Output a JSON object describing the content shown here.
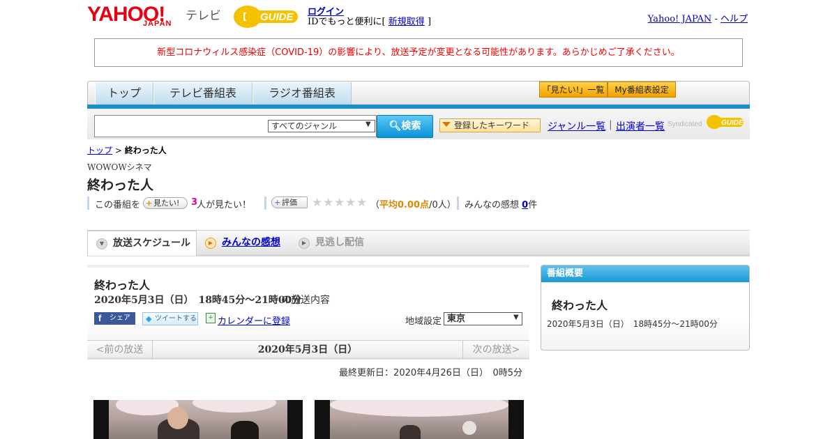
{
  "header": {
    "logo_yahoo": "YAHOO!",
    "logo_japan": "JAPAN",
    "logo_tv": "テレビ",
    "logo_gguide": "GUIDE",
    "login_label": "ログイン",
    "login_sub_prefix": "IDでもっと便利に[",
    "signup_label": "新規取得",
    "login_sub_suffix": "]",
    "yahoo_japan_link": "Yahoo! JAPAN",
    "link_sep": "-",
    "help_link": "ヘルプ"
  },
  "notice": {
    "text": "新型コロナウィルス感染症（COVID-19）の影響により、放送予定が変更となる可能性があります。あらかじめご了承ください。",
    "color": "#ee0000"
  },
  "nav": {
    "tabs": [
      {
        "label": "トップ"
      },
      {
        "label": "テレビ番組表"
      },
      {
        "label": "ラジオ番組表"
      }
    ],
    "mitai_list": "「見たい!」一覧",
    "my_settings": "My番組表設定",
    "accent": "#1a8fc9"
  },
  "search": {
    "input_value": "",
    "genre_selected": "すべてのジャンル",
    "search_label": "検索",
    "keyword_label": "登録したキーワード",
    "genre_list_link": "ジャンル一覧",
    "separator": "|",
    "cast_list_link": "出演者一覧",
    "syndicated": "Syndicated",
    "syndicated_g": "GUIDE"
  },
  "breadcrumb": {
    "top": "トップ",
    "sep": ">",
    "current": "終わった人"
  },
  "program": {
    "channel": "WOWOWシネマ",
    "title": "終わった人",
    "watch_prefix": "この番組を",
    "mitai_pill": "見たい!",
    "watch_count": "3",
    "watch_suffix": "人が見たい！",
    "rate_pill": "評価",
    "rating_stars_filled": 0,
    "rating_stars_total": 5,
    "rating_open": "（",
    "rating_avg": "平均0.00点",
    "rating_rest": "/0人）",
    "impressions_label": "みんなの感想",
    "impressions_count": "0",
    "impressions_unit": "件"
  },
  "subtabs": [
    {
      "label": "放送スケジュール",
      "icon": "chevron-down-icon"
    },
    {
      "label": "みんなの感想",
      "icon": "play-icon"
    },
    {
      "label": "見逃し配信",
      "icon": "play-icon"
    }
  ],
  "schedule": {
    "title": "終わった人",
    "date_time": "2020年5月3日（日）　18時45分～21時00分",
    "date_suffix": "の放送内容",
    "share_label": "シェア",
    "tweet_label": "ツイートする",
    "calendar_label": "カレンダーに登録",
    "region_label": "地域設定",
    "region_value": "東京",
    "prev": "<前の放送",
    "current_date": "2020年5月3日（日）",
    "next": "次の放送>",
    "updated": "最終更新日：2020年4月26日（日）　0時5分"
  },
  "summary": {
    "header": "番組概要",
    "title": "終わった人",
    "date_time": "2020年5月3日（日）　18時45分～21時00分"
  }
}
